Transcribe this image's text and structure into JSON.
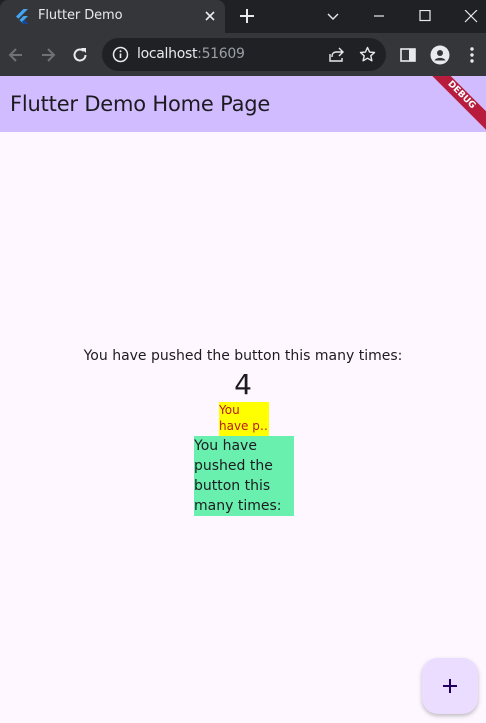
{
  "browser": {
    "tab_title": "Flutter Demo",
    "url_host": "localhost",
    "url_port": ":51609"
  },
  "app": {
    "title": "Flutter Demo Home Page",
    "debug_banner": "DEBUG",
    "counter_label": "You have pushed the button this many times:",
    "counter_value": "4",
    "yellow_line1": "You",
    "yellow_line2": "have p…",
    "green_text": "You have pushed the button this many times:"
  },
  "colors": {
    "app_bar": "#d0bcff",
    "page_bg": "#fef7ff",
    "yellow_box": "#ffff00",
    "green_box": "#69f0ae",
    "fab": "#eaddff"
  },
  "icons": {
    "fab": "add-icon"
  }
}
